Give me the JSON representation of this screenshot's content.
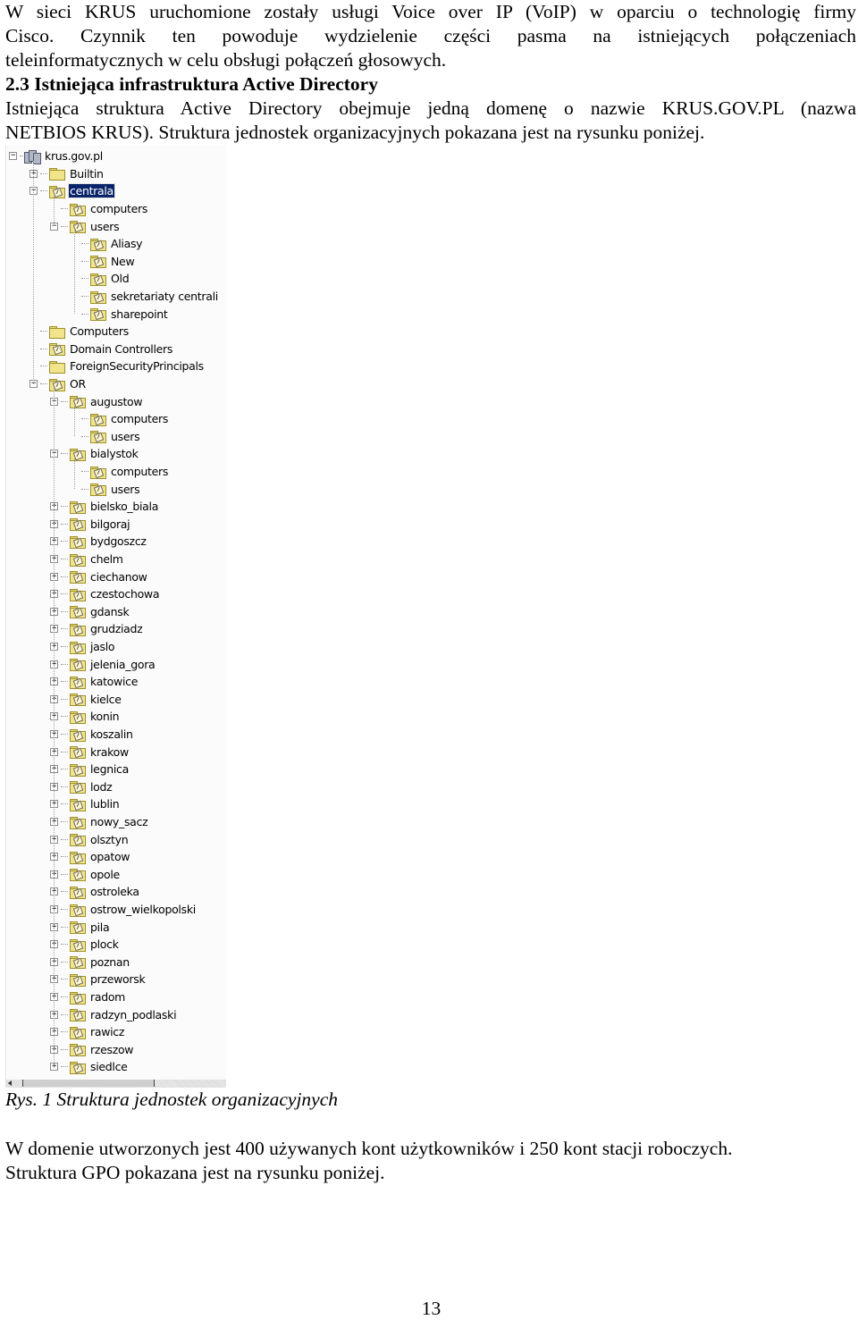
{
  "paragraph1": {
    "lines": [
      "W sieci KRUS uruchomione zostały usługi Voice over IP (VoIP) w oparciu o technologię firmy",
      "Cisco. Czynnik ten powoduje wydzielenie części pasma na istniejących połączeniach",
      "teleinformatycznych w celu obsługi połączeń głosowych."
    ]
  },
  "section_heading": "2.3 Istniejąca infrastruktura Active Directory",
  "paragraph2": {
    "lines": [
      "Istniejąca struktura Active Directory obejmuje jedną domenę o nazwie KRUS.GOV.PL (nazwa",
      "NETBIOS KRUS). Struktura jednostek organizacyjnych pokazana jest na rysunku poniżej."
    ]
  },
  "figure": {
    "caption": "Rys. 1 Struktura jednostek organizacyjnych",
    "tree": [
      {
        "label": "krus.gov.pl",
        "depth": 0,
        "icon": "domain-icon",
        "expander": "minus"
      },
      {
        "label": "Builtin",
        "depth": 1,
        "icon": "folder-icon",
        "expander": "plus"
      },
      {
        "label": "centrala",
        "depth": 1,
        "icon": "ou-folder-icon",
        "expander": "minus",
        "selected": true
      },
      {
        "label": "computers",
        "depth": 2,
        "icon": "ou-folder-icon",
        "expander": "none"
      },
      {
        "label": "users",
        "depth": 2,
        "icon": "ou-folder-icon",
        "expander": "minus"
      },
      {
        "label": "Aliasy",
        "depth": 3,
        "icon": "ou-folder-icon",
        "expander": "none"
      },
      {
        "label": "New",
        "depth": 3,
        "icon": "ou-folder-icon",
        "expander": "none"
      },
      {
        "label": "Old",
        "depth": 3,
        "icon": "ou-folder-icon",
        "expander": "none"
      },
      {
        "label": "sekretariaty centrali",
        "depth": 3,
        "icon": "ou-folder-icon",
        "expander": "none"
      },
      {
        "label": "sharepoint",
        "depth": 3,
        "icon": "ou-folder-icon",
        "expander": "none"
      },
      {
        "label": "Computers",
        "depth": 1,
        "icon": "folder-icon",
        "expander": "none"
      },
      {
        "label": "Domain Controllers",
        "depth": 1,
        "icon": "ou-folder-icon",
        "expander": "none"
      },
      {
        "label": "ForeignSecurityPrincipals",
        "depth": 1,
        "icon": "folder-icon",
        "expander": "none"
      },
      {
        "label": "OR",
        "depth": 1,
        "icon": "ou-folder-icon",
        "expander": "minus"
      },
      {
        "label": "augustow",
        "depth": 2,
        "icon": "ou-folder-icon",
        "expander": "minus"
      },
      {
        "label": "computers",
        "depth": 3,
        "icon": "ou-folder-icon",
        "expander": "none"
      },
      {
        "label": "users",
        "depth": 3,
        "icon": "ou-folder-icon",
        "expander": "none"
      },
      {
        "label": "bialystok",
        "depth": 2,
        "icon": "ou-folder-icon",
        "expander": "minus"
      },
      {
        "label": "computers",
        "depth": 3,
        "icon": "ou-folder-icon",
        "expander": "none"
      },
      {
        "label": "users",
        "depth": 3,
        "icon": "ou-folder-icon",
        "expander": "none"
      },
      {
        "label": "bielsko_biala",
        "depth": 2,
        "icon": "ou-folder-icon",
        "expander": "plus"
      },
      {
        "label": "bilgoraj",
        "depth": 2,
        "icon": "ou-folder-icon",
        "expander": "plus"
      },
      {
        "label": "bydgoszcz",
        "depth": 2,
        "icon": "ou-folder-icon",
        "expander": "plus"
      },
      {
        "label": "chelm",
        "depth": 2,
        "icon": "ou-folder-icon",
        "expander": "plus"
      },
      {
        "label": "ciechanow",
        "depth": 2,
        "icon": "ou-folder-icon",
        "expander": "plus"
      },
      {
        "label": "czestochowa",
        "depth": 2,
        "icon": "ou-folder-icon",
        "expander": "plus"
      },
      {
        "label": "gdansk",
        "depth": 2,
        "icon": "ou-folder-icon",
        "expander": "plus"
      },
      {
        "label": "grudziadz",
        "depth": 2,
        "icon": "ou-folder-icon",
        "expander": "plus"
      },
      {
        "label": "jaslo",
        "depth": 2,
        "icon": "ou-folder-icon",
        "expander": "plus"
      },
      {
        "label": "jelenia_gora",
        "depth": 2,
        "icon": "ou-folder-icon",
        "expander": "plus"
      },
      {
        "label": "katowice",
        "depth": 2,
        "icon": "ou-folder-icon",
        "expander": "plus"
      },
      {
        "label": "kielce",
        "depth": 2,
        "icon": "ou-folder-icon",
        "expander": "plus"
      },
      {
        "label": "konin",
        "depth": 2,
        "icon": "ou-folder-icon",
        "expander": "plus"
      },
      {
        "label": "koszalin",
        "depth": 2,
        "icon": "ou-folder-icon",
        "expander": "plus"
      },
      {
        "label": "krakow",
        "depth": 2,
        "icon": "ou-folder-icon",
        "expander": "plus"
      },
      {
        "label": "legnica",
        "depth": 2,
        "icon": "ou-folder-icon",
        "expander": "plus"
      },
      {
        "label": "lodz",
        "depth": 2,
        "icon": "ou-folder-icon",
        "expander": "plus"
      },
      {
        "label": "lublin",
        "depth": 2,
        "icon": "ou-folder-icon",
        "expander": "plus"
      },
      {
        "label": "nowy_sacz",
        "depth": 2,
        "icon": "ou-folder-icon",
        "expander": "plus"
      },
      {
        "label": "olsztyn",
        "depth": 2,
        "icon": "ou-folder-icon",
        "expander": "plus"
      },
      {
        "label": "opatow",
        "depth": 2,
        "icon": "ou-folder-icon",
        "expander": "plus"
      },
      {
        "label": "opole",
        "depth": 2,
        "icon": "ou-folder-icon",
        "expander": "plus"
      },
      {
        "label": "ostroleka",
        "depth": 2,
        "icon": "ou-folder-icon",
        "expander": "plus"
      },
      {
        "label": "ostrow_wielkopolski",
        "depth": 2,
        "icon": "ou-folder-icon",
        "expander": "plus"
      },
      {
        "label": "pila",
        "depth": 2,
        "icon": "ou-folder-icon",
        "expander": "plus"
      },
      {
        "label": "plock",
        "depth": 2,
        "icon": "ou-folder-icon",
        "expander": "plus"
      },
      {
        "label": "poznan",
        "depth": 2,
        "icon": "ou-folder-icon",
        "expander": "plus"
      },
      {
        "label": "przeworsk",
        "depth": 2,
        "icon": "ou-folder-icon",
        "expander": "plus"
      },
      {
        "label": "radom",
        "depth": 2,
        "icon": "ou-folder-icon",
        "expander": "plus"
      },
      {
        "label": "radzyn_podlaski",
        "depth": 2,
        "icon": "ou-folder-icon",
        "expander": "plus"
      },
      {
        "label": "rawicz",
        "depth": 2,
        "icon": "ou-folder-icon",
        "expander": "plus"
      },
      {
        "label": "rzeszow",
        "depth": 2,
        "icon": "ou-folder-icon",
        "expander": "plus"
      },
      {
        "label": "siedlce",
        "depth": 2,
        "icon": "ou-folder-icon",
        "expander": "plus"
      }
    ],
    "selection_color": "#0a246a"
  },
  "paragraph3": {
    "lines": [
      "W domenie utworzonych jest 400 używanych kont użytkowników i 250 kont stacji roboczych.",
      "Struktura GPO pokazana jest na rysunku poniżej."
    ]
  },
  "page_number": "13"
}
